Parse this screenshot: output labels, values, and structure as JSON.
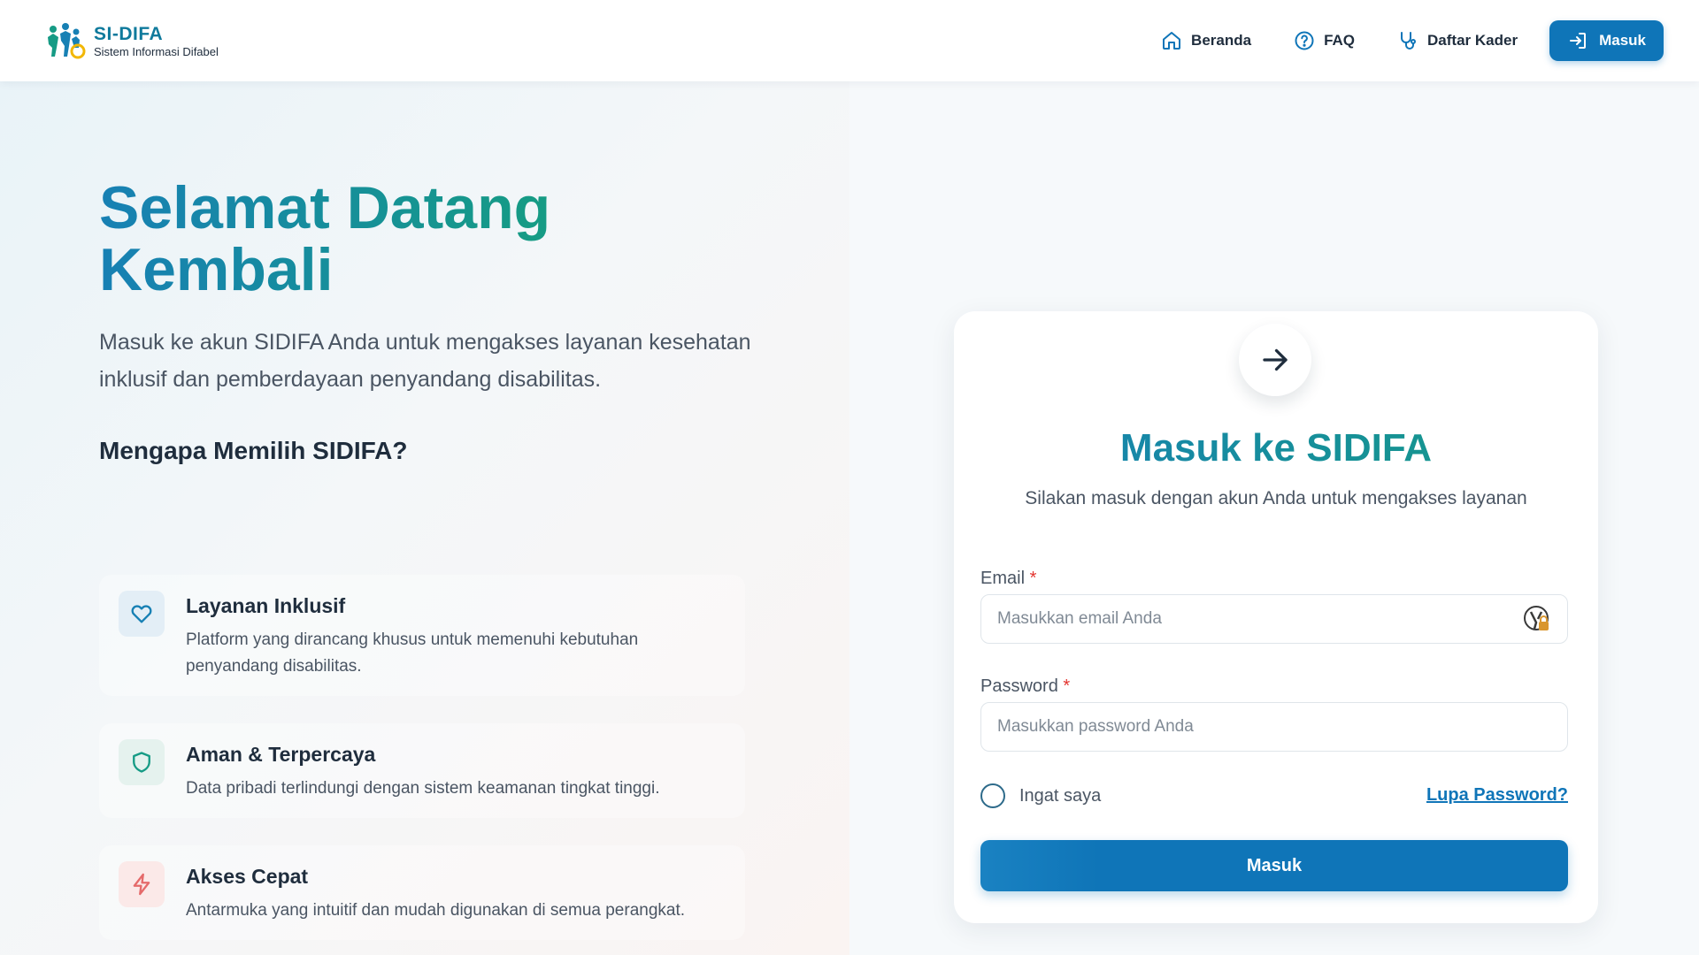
{
  "nav": {
    "brand_name": "SI-DIFA",
    "brand_subtitle": "Sistem Informasi Difabel",
    "links": [
      {
        "label": "Beranda",
        "icon": "home-icon"
      },
      {
        "label": "FAQ",
        "icon": "help-circle-icon"
      },
      {
        "label": "Daftar Kader",
        "icon": "stethoscope-icon"
      }
    ],
    "login_button": {
      "label": "Masuk",
      "icon": "login-icon"
    }
  },
  "hero": {
    "title_line1": "Selamat Datang",
    "title_line2": "Kembali",
    "subtitle": "Masuk ke akun SIDIFA Anda untuk mengakses layanan kesehatan inklusif dan pemberdayaan penyandang disabilitas."
  },
  "why": {
    "title": "Mengapa Memilih SIDIFA?",
    "features": [
      {
        "title": "Layanan Inklusif",
        "desc": "Platform yang dirancang khusus untuk memenuhi kebutuhan penyandang disabilitas.",
        "icon": "heart-icon",
        "color": "#1780b4"
      },
      {
        "title": "Aman & Terpercaya",
        "desc": "Data pribadi terlindungi dengan sistem keamanan tingkat tinggi.",
        "icon": "shield-icon",
        "color": "#169b85"
      },
      {
        "title": "Akses Cepat",
        "desc": "Antarmuka yang intuitif dan mudah digunakan di semua perangkat.",
        "icon": "lightning-icon",
        "color": "#e56a6a"
      }
    ]
  },
  "login": {
    "title": "Masuk ke SIDIFA",
    "subtitle": "Silakan masuk dengan akun Anda untuk mengakses layanan",
    "email_label": "Email",
    "email_placeholder": "Masukkan email Anda",
    "email_value": "",
    "password_label": "Password",
    "password_placeholder": "Masukkan password Anda",
    "password_value": "",
    "required_mark": "*",
    "remember_label": "Ingat saya",
    "remember_checked": false,
    "forgot_label": "Lupa Password?",
    "submit_label": "Masuk"
  },
  "colors": {
    "primary": "#0f75b8",
    "accent_teal": "#169b85",
    "required": "#e3342f"
  }
}
